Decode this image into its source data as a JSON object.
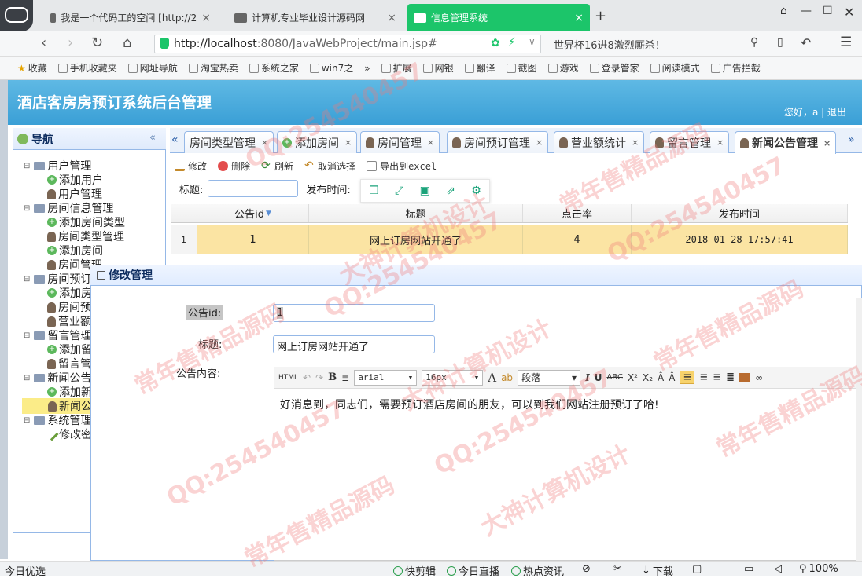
{
  "browser": {
    "tabs": [
      {
        "title": "我是一个代码工的空间 [http://2",
        "active": false
      },
      {
        "title": "计算机专业毕业设计源码网",
        "active": false
      },
      {
        "title": "信息管理系统",
        "active": true
      }
    ],
    "new_tab": "+",
    "url_host": "http://localhost",
    "url_rest": ":8080/JavaWebProject/main.jsp#",
    "search_text": "世界杯16进8激烈厮杀！",
    "bookmarks": [
      "收藏",
      "手机收藏夹",
      "网址导航",
      "淘宝热卖",
      "系统之家",
      "win7之",
      "»",
      "扩展",
      "网银",
      "翻译",
      "截图",
      "游戏",
      "登录管家",
      "阅读模式",
      "广告拦截"
    ]
  },
  "app": {
    "title": "酒店客房房预订系统后台管理",
    "greeting": "您好，a  |  退出"
  },
  "nav": {
    "header": "导航",
    "collapse": "«",
    "groups": [
      {
        "label": "用户管理",
        "items": [
          "添加用户",
          "用户管理"
        ]
      },
      {
        "label": "房间信息管理",
        "items": [
          "添加房间类型",
          "房间类型管理",
          "添加房间",
          "房间管理"
        ]
      },
      {
        "label": "房间预订",
        "items": [
          "添加房",
          "房间预",
          "营业额"
        ]
      },
      {
        "label": "留言管理",
        "items": [
          "添加留",
          "留言管"
        ]
      },
      {
        "label": "新闻公告",
        "items": [
          "添加新",
          "新闻公"
        ]
      },
      {
        "label": "系统管理",
        "items": [
          "修改密"
        ]
      }
    ],
    "selected": "新闻公"
  },
  "content_tabs": {
    "prev": "«",
    "next": "»",
    "items": [
      "房间类型管理",
      "添加房间",
      "房间管理",
      "房间预订管理",
      "营业额统计",
      "留言管理",
      "新闻公告管理"
    ],
    "active": "新闻公告管理",
    "close": "×"
  },
  "toolbar": {
    "edit": "修改",
    "delete": "删除",
    "refresh": "刷新",
    "cancel": "取消选择",
    "export": "导出到excel"
  },
  "filter": {
    "title_label": "标题:",
    "time_label": "发布时间:"
  },
  "grid": {
    "columns": [
      "公告id",
      "标题",
      "点击率",
      "发布时间"
    ],
    "sort_indicator": "▼",
    "rows": [
      {
        "num": "1",
        "id": "1",
        "title": "网上订房网站开通了",
        "hits": "4",
        "time": "2018-01-28 17:57:41"
      }
    ]
  },
  "modal": {
    "title": "修改管理",
    "id_label": "公告id:",
    "id_value": "1",
    "title_label": "标题:",
    "title_value": "网上订房网站开通了",
    "content_label": "公告内容:",
    "editor": {
      "html": "HTML",
      "font": "arial",
      "size": "16px",
      "para": "段落",
      "content": "好消息到，同志们，需要预订酒店房间的朋友，可以到我们网站注册预订了哈!"
    }
  },
  "statusbar": {
    "left": "今日优选",
    "items": [
      "快剪辑",
      "今日直播",
      "热点资讯",
      "下载",
      "100%"
    ]
  },
  "watermark": {
    "qq": "QQ:254540457",
    "text1": "常年售精品源码",
    "text2": "大神计算机设计"
  },
  "colors": {
    "header_blue": "#3a9fd6",
    "active_tab_green": "#1cc56a",
    "selected_row": "#fbe4a3",
    "panel_border": "#95b8e7"
  }
}
